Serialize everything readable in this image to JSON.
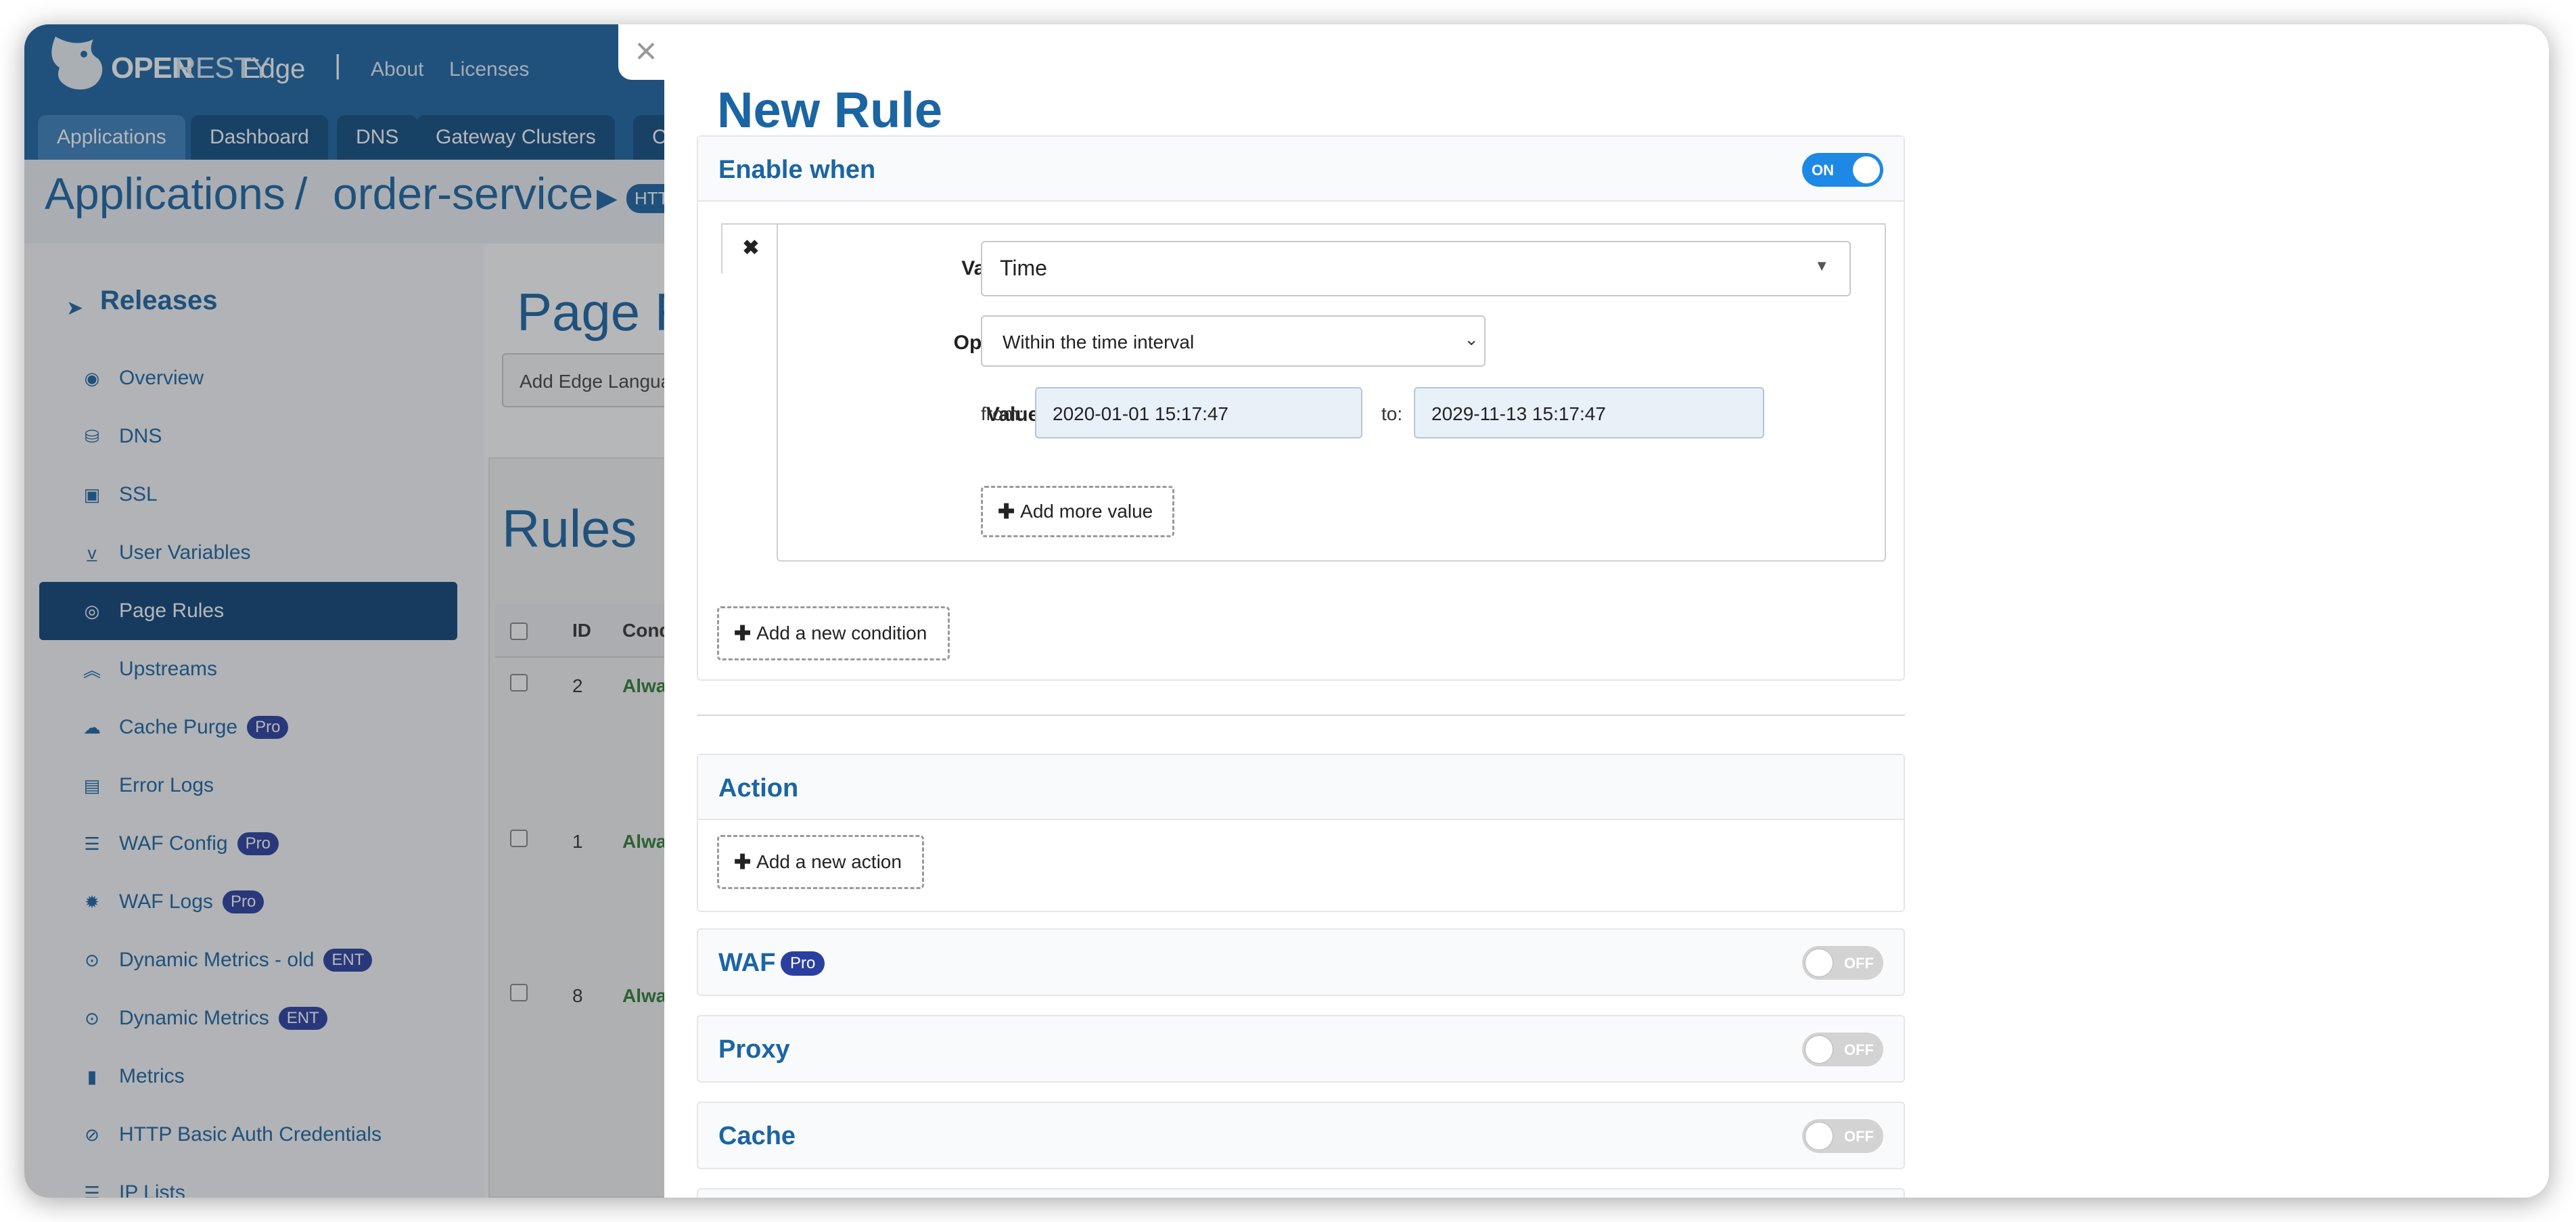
{
  "app": {
    "brand_open": "OPEN",
    "brand_resty": "RESTY",
    "brand_edge": "Edge",
    "separator": "|",
    "links": [
      "About",
      "Licenses"
    ]
  },
  "nav_tabs": [
    "Applications",
    "Dashboard",
    "DNS",
    "Gateway Clusters",
    "C"
  ],
  "breadcrumb": {
    "root": "Applications",
    "slash": "/",
    "current": "order-service",
    "badge": "HTTP"
  },
  "sidebar": {
    "section": "Releases",
    "items": [
      {
        "label": "Overview",
        "icon": "gauge-icon"
      },
      {
        "label": "DNS",
        "icon": "database-icon"
      },
      {
        "label": "SSL",
        "icon": "certificate-icon"
      },
      {
        "label": "User Variables",
        "icon": "var-icon"
      },
      {
        "label": "Page Rules",
        "icon": "rule-icon"
      },
      {
        "label": "Upstreams",
        "icon": "chevron-up-icon"
      },
      {
        "label": "Cache Purge",
        "icon": "cloud-icon",
        "badge": "Pro"
      },
      {
        "label": "Error Logs",
        "icon": "file-icon"
      },
      {
        "label": "WAF Config",
        "icon": "list-icon",
        "badge": "Pro"
      },
      {
        "label": "WAF Logs",
        "icon": "bug-icon",
        "badge": "Pro"
      },
      {
        "label": "Dynamic Metrics - old",
        "icon": "pin-icon",
        "badge": "ENT"
      },
      {
        "label": "Dynamic Metrics",
        "icon": "pin-icon",
        "badge": "ENT"
      },
      {
        "label": "Metrics",
        "icon": "bar-chart-icon"
      },
      {
        "label": "HTTP Basic Auth Credentials",
        "icon": "lock-icon"
      },
      {
        "label": "IP Lists",
        "icon": "list-icon"
      }
    ]
  },
  "main": {
    "page_title": "Page R",
    "add_button": "Add Edge Langua",
    "rules_title": "Rules",
    "table_headers": [
      "ID",
      "Conditi"
    ],
    "rows": [
      {
        "id": "2",
        "cond": "Always"
      },
      {
        "id": "1",
        "cond": "Always"
      },
      {
        "id": "8",
        "cond": "Always"
      }
    ]
  },
  "modal": {
    "close": "×",
    "title": "New Rule",
    "enable_when": {
      "title": "Enable when",
      "toggle": "ON",
      "remove": "✖",
      "variable_label": "Variable",
      "variable_value": "Time",
      "operator_label": "Operator",
      "operator_value": "Within the time interval",
      "value_label": "Value",
      "from_label": "from:",
      "from_value": "2020-01-01 15:17:47",
      "to_label": "to:",
      "to_value": "2029-11-13 15:17:47",
      "add_more_value": "Add more value",
      "add_condition": "Add a new condition",
      "required_mark": "*"
    },
    "action": {
      "title": "Action",
      "add_action": "Add a new action"
    },
    "waf": {
      "title": "WAF",
      "badge": "Pro",
      "toggle": "OFF"
    },
    "proxy": {
      "title": "Proxy",
      "toggle": "OFF"
    },
    "cache": {
      "title": "Cache",
      "toggle": "OFF"
    }
  },
  "colors": {
    "accent": "#1b65a3",
    "toggle_on": "#1e88e5",
    "toggle_off": "#d3d3d3",
    "badge": "#2a3fa0"
  }
}
